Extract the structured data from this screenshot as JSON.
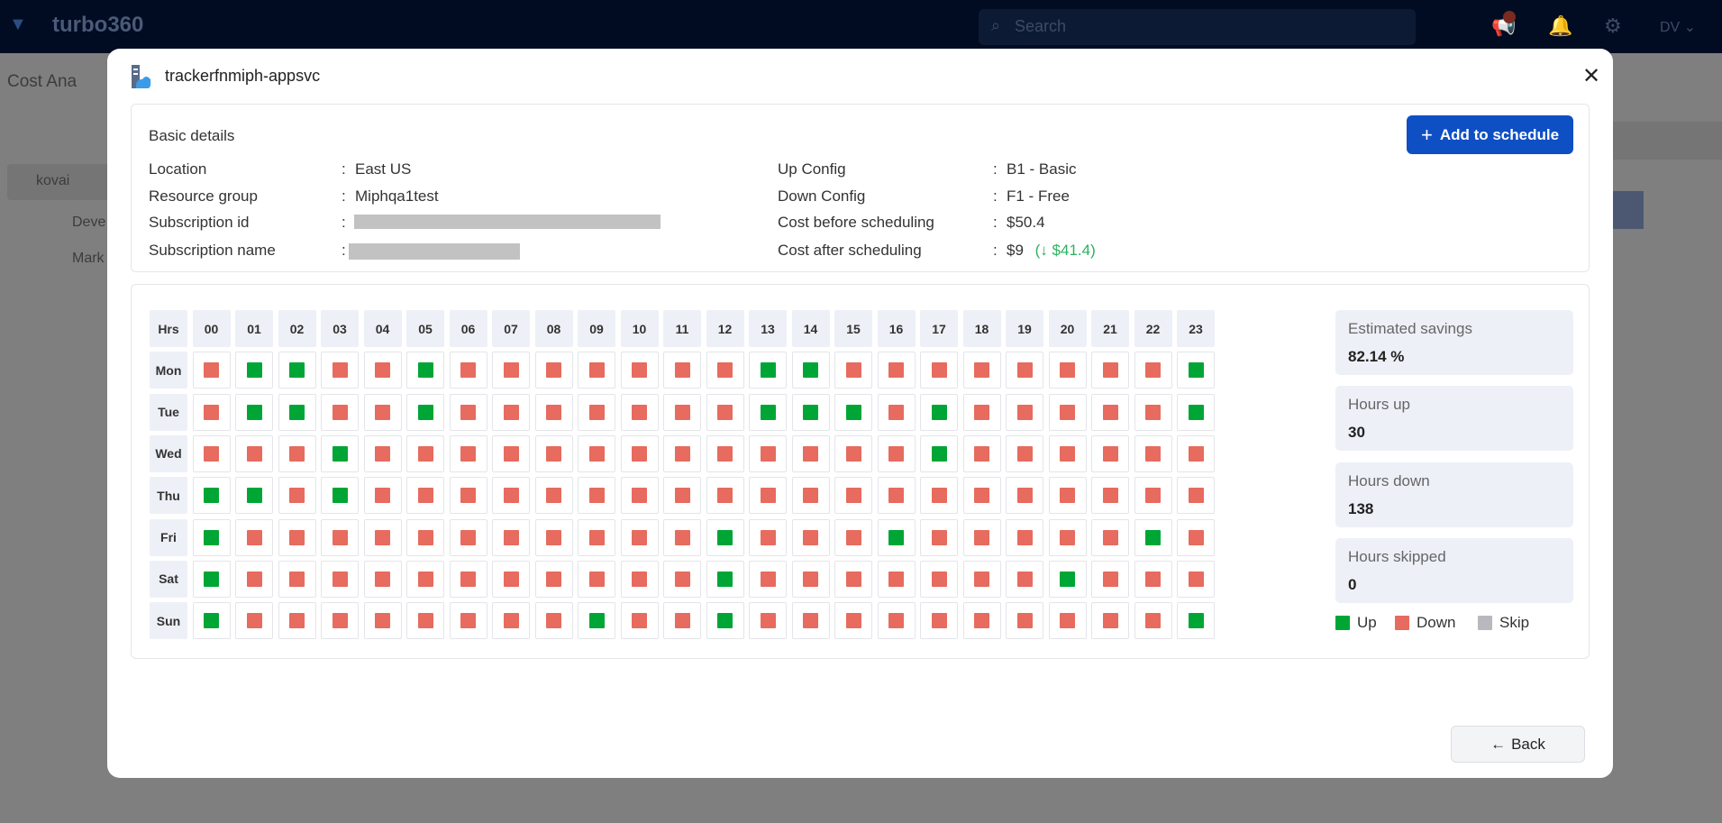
{
  "app": {
    "name": "turbo360",
    "search_placeholder": "Search",
    "user_initials": "DV"
  },
  "background": {
    "page_title": "Cost Ana",
    "tree": [
      "kovai",
      "Deve",
      "Mark"
    ]
  },
  "modal": {
    "title": "trackerfnmiph-appsvc",
    "basic_details": {
      "heading": "Basic details",
      "add_button": "Add to schedule",
      "left": [
        {
          "label": "Location",
          "value": "East US"
        },
        {
          "label": "Resource group",
          "value": "Miphqa1test"
        },
        {
          "label": "Subscription id",
          "value": ""
        },
        {
          "label": "Subscription name",
          "value": ""
        }
      ],
      "right": [
        {
          "label": "Up Config",
          "value": "B1 - Basic"
        },
        {
          "label": "Down Config",
          "value": "F1 - Free"
        },
        {
          "label": "Cost before scheduling",
          "value": "$50.4"
        },
        {
          "label": "Cost after scheduling",
          "value": "$9",
          "savings": "(↓ $41.4)"
        }
      ]
    },
    "schedule": {
      "corner": "Hrs",
      "hours": [
        "00",
        "01",
        "02",
        "03",
        "04",
        "05",
        "06",
        "07",
        "08",
        "09",
        "10",
        "11",
        "12",
        "13",
        "14",
        "15",
        "16",
        "17",
        "18",
        "19",
        "20",
        "21",
        "22",
        "23"
      ],
      "days": [
        {
          "day": "Mon",
          "up": [
            1,
            2,
            5,
            13,
            14,
            23
          ]
        },
        {
          "day": "Tue",
          "up": [
            1,
            2,
            5,
            13,
            14,
            15,
            17,
            23
          ]
        },
        {
          "day": "Wed",
          "up": [
            3,
            17
          ]
        },
        {
          "day": "Thu",
          "up": [
            0,
            1,
            3
          ]
        },
        {
          "day": "Fri",
          "up": [
            0,
            12,
            16,
            22
          ]
        },
        {
          "day": "Sat",
          "up": [
            0,
            12,
            20
          ]
        },
        {
          "day": "Sun",
          "up": [
            0,
            9,
            12,
            23
          ]
        }
      ],
      "colors": {
        "up": "#00a635",
        "down": "#e76b5e",
        "skip": "#b9b8be"
      }
    },
    "stats": [
      {
        "label": "Estimated savings",
        "value": "82.14 %"
      },
      {
        "label": "Hours up",
        "value": "30"
      },
      {
        "label": "Hours down",
        "value": "138"
      },
      {
        "label": "Hours skipped",
        "value": "0"
      }
    ],
    "legend": {
      "up": "Up",
      "down": "Down",
      "skip": "Skip"
    },
    "back_button": "Back"
  }
}
